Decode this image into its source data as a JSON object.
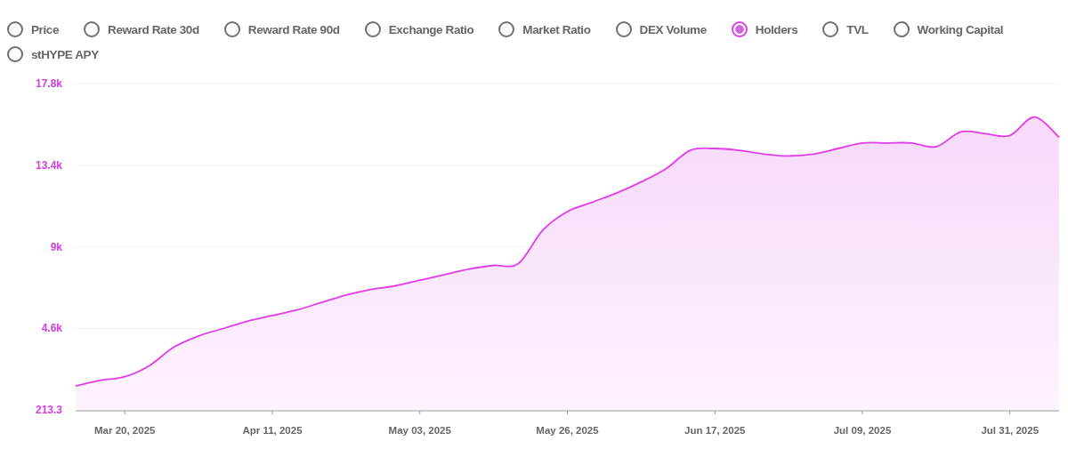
{
  "legend": [
    {
      "label": "Price",
      "selected": false
    },
    {
      "label": "Reward Rate 30d",
      "selected": false
    },
    {
      "label": "Reward Rate 90d",
      "selected": false
    },
    {
      "label": "Exchange Ratio",
      "selected": false
    },
    {
      "label": "Market Ratio",
      "selected": false
    },
    {
      "label": "DEX Volume",
      "selected": false
    },
    {
      "label": "Holders",
      "selected": true
    },
    {
      "label": "TVL",
      "selected": false
    },
    {
      "label": "Working Capital",
      "selected": false
    },
    {
      "label": "stHYPE APY",
      "selected": false
    }
  ],
  "chart": {
    "chart_data": {
      "type": "area",
      "grid": true,
      "ylim": [
        213.3,
        17800
      ],
      "categories": [
        null,
        null,
        "Mar 20, 2025",
        null,
        null,
        null,
        null,
        null,
        "Apr 11, 2025",
        null,
        null,
        null,
        null,
        null,
        "May 03, 2025",
        null,
        null,
        null,
        null,
        null,
        "May 26, 2025",
        null,
        null,
        null,
        null,
        null,
        "Jun 17, 2025",
        null,
        null,
        null,
        null,
        null,
        "Jul 09, 2025",
        null,
        null,
        null,
        null,
        null,
        "Jul 31, 2025",
        null,
        null
      ],
      "yticks": [
        {
          "value": 213.3,
          "label": "213.3"
        },
        {
          "value": 4600,
          "label": "4.6k"
        },
        {
          "value": 9000,
          "label": "9k"
        },
        {
          "value": 13400,
          "label": "13.4k"
        },
        {
          "value": 17800,
          "label": "17.8k"
        }
      ],
      "series": [
        {
          "color": "#e03ce8",
          "values": [
            1500,
            1800,
            2000,
            2600,
            3600,
            4200,
            4600,
            5000,
            5300,
            5600,
            6000,
            6400,
            6700,
            6900,
            7200,
            7500,
            7800,
            8000,
            8100,
            9900,
            10900,
            11400,
            11900,
            12500,
            13200,
            14200,
            14300,
            14200,
            14000,
            13900,
            14000,
            14300,
            14600,
            14600,
            14600,
            14400,
            15200,
            15100,
            15000,
            16000,
            14900
          ]
        }
      ]
    }
  }
}
